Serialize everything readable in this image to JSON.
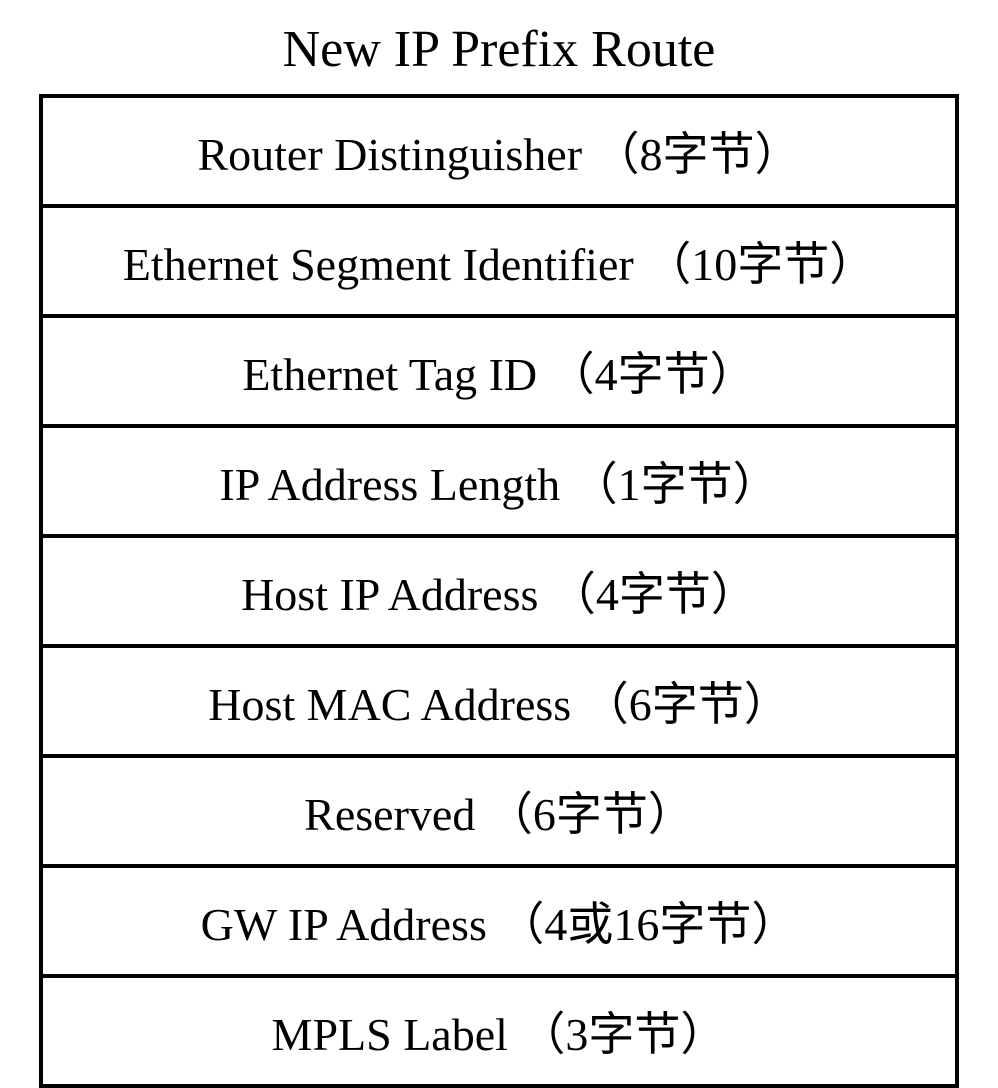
{
  "title": "New IP Prefix Route",
  "rows": [
    "Router Distinguisher （8字节）",
    "Ethernet Segment Identifier （10字节）",
    "Ethernet Tag ID （4字节）",
    "IP Address Length （1字节）",
    "Host IP Address （4字节）",
    "Host MAC Address （6字节）",
    "Reserved （6字节）",
    "GW IP Address （4或16字节）",
    "MPLS Label （3字节）"
  ]
}
